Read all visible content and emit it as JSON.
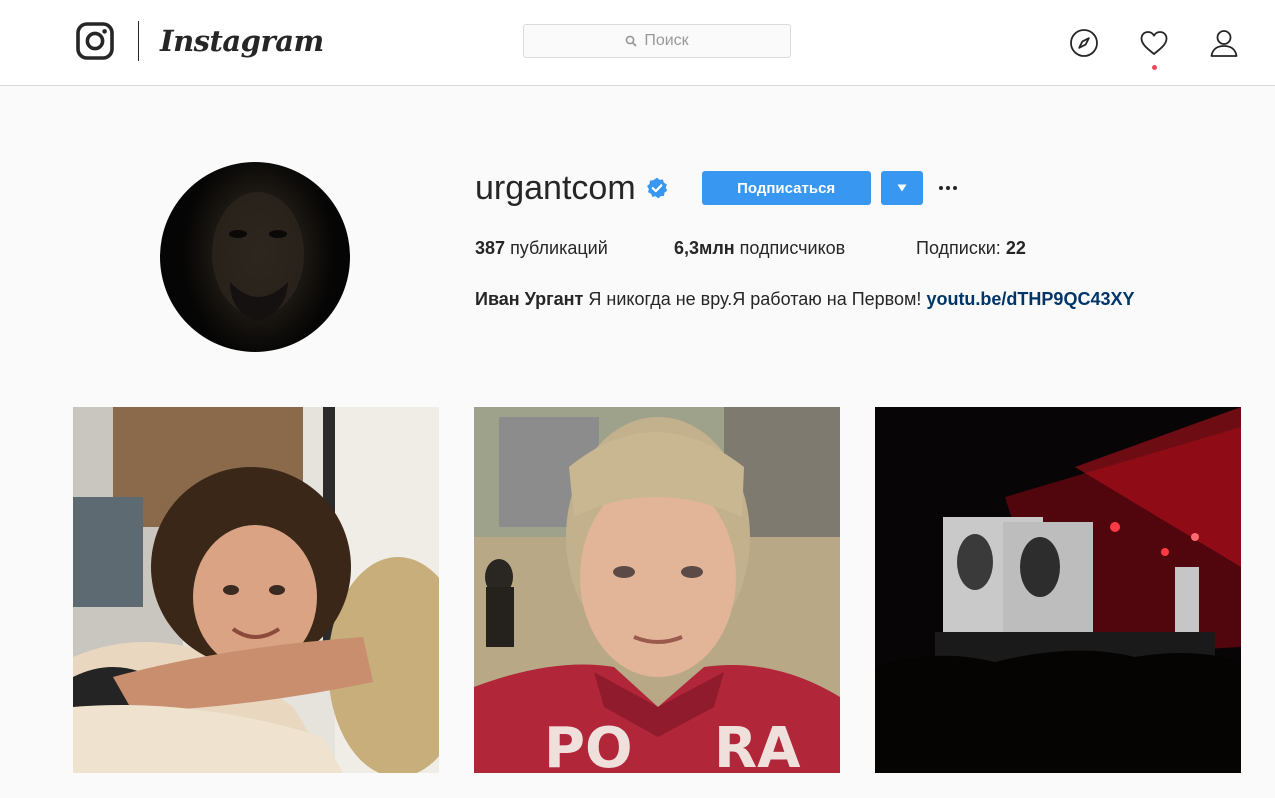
{
  "nav": {
    "brand_wordmark": "Instagram",
    "search_placeholder": "Поиск",
    "icons": [
      "instagram-glyph-icon",
      "explore-compass-icon",
      "activity-heart-icon",
      "profile-user-icon",
      "search-icon"
    ]
  },
  "profile": {
    "username": "urgantcom",
    "verified": true,
    "follow_label": "Подписаться",
    "stats": {
      "posts_count": "387",
      "posts_label": "публикаций",
      "followers_count": "6,3млн",
      "followers_label": "подписчиков",
      "following_label": "Подписки:",
      "following_count": "22"
    },
    "bio": {
      "full_name": "Иван Ургант",
      "text": "Я никогда не вру.Я работаю на Первом!",
      "link": "youtu.be/dTHP9QC43XY"
    }
  },
  "colors": {
    "accent_blue": "#3897f0",
    "link_blue": "#003569",
    "notification_red": "#ed4956",
    "background": "#fafafa"
  },
  "posts": [
    {
      "subject": "girl-smiling"
    },
    {
      "subject": "man-selfie-red-jacket"
    },
    {
      "subject": "concert-stage"
    }
  ]
}
